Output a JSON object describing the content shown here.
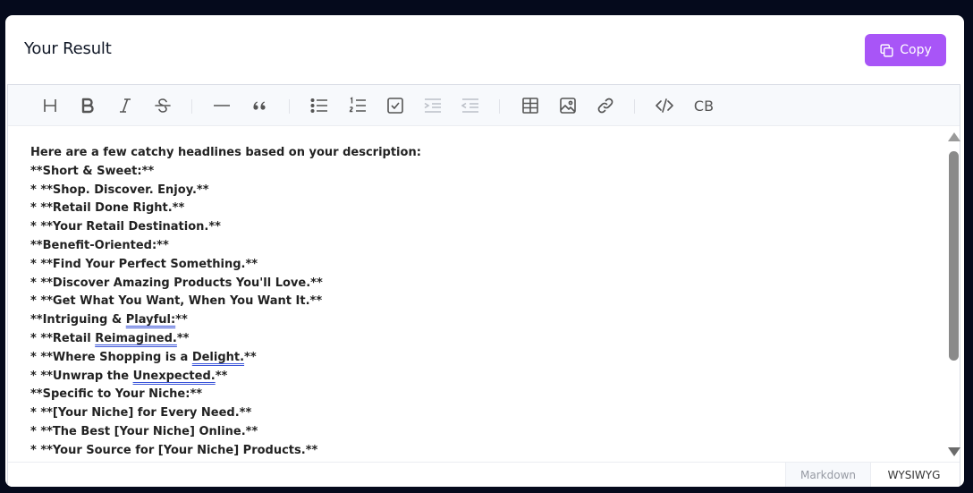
{
  "header": {
    "title": "Your Result",
    "copy_label": "Copy"
  },
  "toolbar": {
    "buttons": [
      {
        "name": "heading",
        "icon": "heading-icon"
      },
      {
        "name": "bold",
        "icon": "bold-icon"
      },
      {
        "name": "italic",
        "icon": "italic-icon"
      },
      {
        "name": "strike",
        "icon": "strikethrough-icon"
      },
      {
        "name": "hr",
        "icon": "horizontal-rule-icon"
      },
      {
        "name": "quote",
        "icon": "quote-icon"
      },
      {
        "name": "ul",
        "icon": "bullet-list-icon"
      },
      {
        "name": "ol",
        "icon": "ordered-list-icon"
      },
      {
        "name": "task",
        "icon": "task-list-icon"
      },
      {
        "name": "indent",
        "icon": "indent-icon"
      },
      {
        "name": "outdent",
        "icon": "outdent-icon"
      },
      {
        "name": "table",
        "icon": "table-icon"
      },
      {
        "name": "image",
        "icon": "image-icon"
      },
      {
        "name": "link",
        "icon": "link-icon"
      },
      {
        "name": "code",
        "icon": "code-icon"
      },
      {
        "name": "codeblock",
        "icon": "code-block-icon",
        "label": "CB"
      }
    ]
  },
  "content": {
    "lines": [
      "Here are a few catchy headlines based on your description:",
      "**Short & Sweet:**",
      "* **Shop. Discover. Enjoy.**",
      "* **Retail Done Right.**",
      "* **Your Retail Destination.**",
      "**Benefit-Oriented:**",
      "* **Find Your Perfect Something.**",
      "* **Discover Amazing Products You'll Love.**",
      "* **Get What You Want, When You Want It.**",
      "**Intriguing & Playful:**",
      "* **Retail Reimagined.**",
      "* **Where Shopping is a Delight.**",
      "* **Unwrap the Unexpected.**",
      "**Specific to Your Niche:**",
      "* **[Your Niche] for Every Need.**",
      "* **The Best [Your Niche] Online.**",
      "* **Your Source for [Your Niche] Products.**"
    ],
    "spellcheck": {
      "line9_pre": "**Intriguing & ",
      "line9_word": "Playful:",
      "line9_post": "**",
      "line10_pre": "* **Retail ",
      "line10_word": "Reimagined.",
      "line10_post": "**",
      "line11_pre": "* **Where Shopping is a ",
      "line11_word": "Delight.",
      "line11_post": "**",
      "line12_pre": "* **Unwrap the ",
      "line12_word": "Unexpected.",
      "line12_post": "**"
    }
  },
  "modes": {
    "markdown": "Markdown",
    "wysiwyg": "WYSIWYG",
    "active": "wysiwyg"
  },
  "colors": {
    "accent": "#a855f7",
    "background": "#050a1c",
    "spellcheck_underline": "#3b55d9"
  }
}
